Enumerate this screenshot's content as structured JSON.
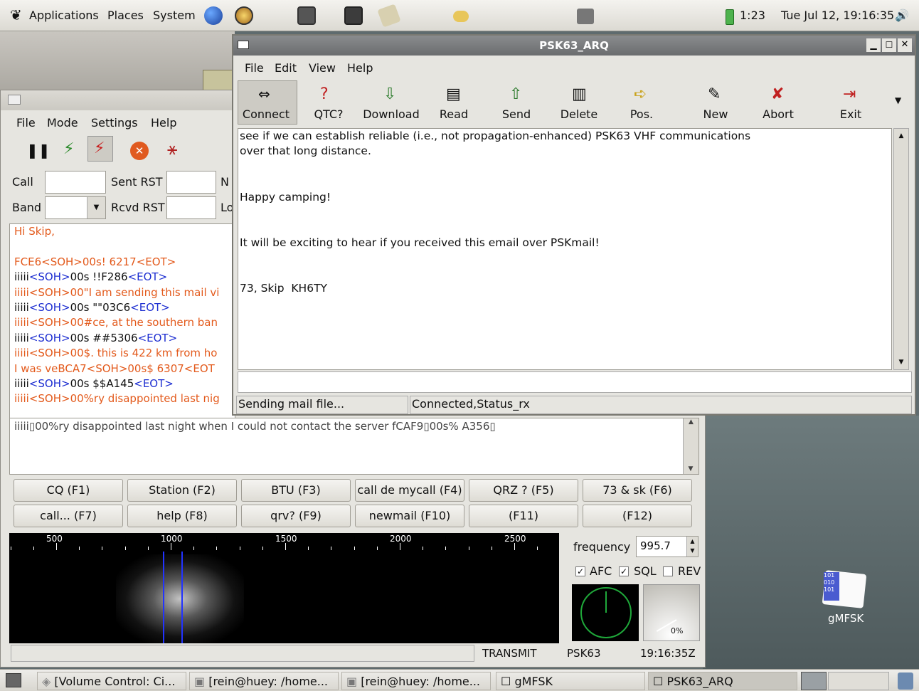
{
  "top_panel": {
    "menus": [
      "Applications",
      "Places",
      "System"
    ],
    "battery": "1:23",
    "clock": "Tue Jul 12, 19:16:35"
  },
  "gmfsk": {
    "menu": [
      "File",
      "Mode",
      "Settings",
      "Help"
    ],
    "call_label": "Call",
    "sent_rst_label": "Sent RST",
    "n_label": "N",
    "band_label": "Band",
    "rcvd_rst_label": "Rcvd RST",
    "lo_label": "Lo",
    "rx_lines": [
      [
        {
          "t": "Hi Skip,",
          "c": "or"
        }
      ],
      [],
      [
        {
          "t": "FCE6<SOH>00s!  6217<EOT>",
          "c": "or"
        }
      ],
      [
        {
          "t": "iiiii",
          "c": "bk"
        },
        {
          "t": "<SOH>",
          "c": "bl"
        },
        {
          "t": "00s !!F286",
          "c": "bk"
        },
        {
          "t": "<EOT>",
          "c": "bl"
        }
      ],
      [
        {
          "t": "iiiii<SOH>00\"I am sending this mail vi",
          "c": "or"
        }
      ],
      [
        {
          "t": "iiiii",
          "c": "bk"
        },
        {
          "t": "<SOH>",
          "c": "bl"
        },
        {
          "t": "00s \"\"03C6",
          "c": "bk"
        },
        {
          "t": "<EOT>",
          "c": "bl"
        }
      ],
      [
        {
          "t": "iiiii<SOH>00#ce, at the southern ban",
          "c": "or"
        }
      ],
      [
        {
          "t": "iiiii",
          "c": "bk"
        },
        {
          "t": "<SOH>",
          "c": "bl"
        },
        {
          "t": "00s ##5306",
          "c": "bk"
        },
        {
          "t": "<EOT>",
          "c": "bl"
        }
      ],
      [
        {
          "t": "iiiii<SOH>00$. this is 422 km from ho",
          "c": "or"
        }
      ],
      [
        {
          "t": "I was veBCA7<SOH>00s$  6307<EOT",
          "c": "or"
        }
      ],
      [
        {
          "t": "iiiii",
          "c": "bk"
        },
        {
          "t": "<SOH>",
          "c": "bl"
        },
        {
          "t": "00s $$A145",
          "c": "bk"
        },
        {
          "t": "<EOT>",
          "c": "bl"
        }
      ],
      [
        {
          "t": "iiiii<SOH>00%ry disappointed last nig",
          "c": "or"
        }
      ]
    ],
    "tx_line": "iiiii▯00%ry disappointed last night when I could not contact the server fCAF9▯00s%  A356▯",
    "macros": [
      "CQ (F1)",
      "Station (F2)",
      "BTU (F3)",
      "call de mycall (F4)",
      "QRZ ? (F5)",
      "73 & sk (F6)",
      "call... (F7)",
      "help (F8)",
      "qrv? (F9)",
      "newmail (F10)",
      "(F11)",
      "(F12)"
    ],
    "wf_ticks": [
      "500",
      "1000",
      "1500",
      "2000",
      "2500"
    ],
    "frequency_label": "frequency",
    "frequency_value": "995.7",
    "afc": "AFC",
    "sql": "SQL",
    "rev": "REV",
    "meter_readout": "0%",
    "status": {
      "transmit": "TRANSMIT",
      "mode": "PSK63",
      "time": "19:16:35Z"
    }
  },
  "psk": {
    "title": "PSK63_ARQ",
    "menu": [
      "File",
      "Edit",
      "View",
      "Help"
    ],
    "toolbar": [
      "Connect",
      "QTC?",
      "Download",
      "Read",
      "Send",
      "Delete",
      "Pos.",
      "New",
      "Abort",
      "Exit"
    ],
    "message": "see if we can establish reliable (i.e., not propagation-enhanced) PSK63 VHF communications\nover that long distance.\n\n\nHappy camping!\n\n\nIt will be exciting to hear if you received this email over PSKmail!\n\n\n73, Skip  KH6TY",
    "status_left": "Sending mail file...",
    "status_right": "Connected,Status_rx"
  },
  "desktop_icon": "gMFSK",
  "taskbar": [
    "[Volume Control: Ci...",
    "[rein@huey: /home...",
    "[rein@huey: /home...",
    "gMFSK",
    "PSK63_ARQ"
  ]
}
